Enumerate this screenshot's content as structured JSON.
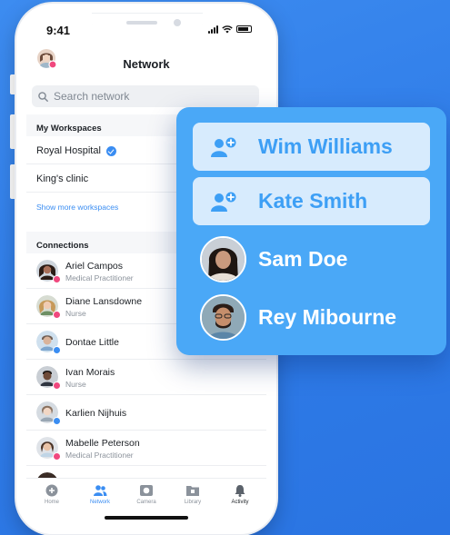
{
  "status": {
    "time": "9:41"
  },
  "header": {
    "title": "Network"
  },
  "search": {
    "placeholder": "Search network"
  },
  "workspaces": {
    "heading": "My Workspaces",
    "items": [
      {
        "name": "Royal Hospital",
        "verified": true
      },
      {
        "name": "King's clinic",
        "verified": false
      }
    ],
    "show_more": "Show more workspaces"
  },
  "connections": {
    "heading": "Connections",
    "items": [
      {
        "name": "Ariel Campos",
        "role": "Medical Practitioner",
        "badge": "pink"
      },
      {
        "name": "Diane Lansdowne",
        "role": "Nurse",
        "badge": "pink"
      },
      {
        "name": "Dontae Little",
        "role": "",
        "badge": "blue"
      },
      {
        "name": "Ivan Morais",
        "role": "Nurse",
        "badge": "pink"
      },
      {
        "name": "Karlien Nijhuis",
        "role": "",
        "badge": "blue"
      },
      {
        "name": "Mabelle Peterson",
        "role": "Medical Practitioner",
        "badge": "pink"
      }
    ]
  },
  "tabs": [
    {
      "label": "Home",
      "icon": "home-icon",
      "active": false
    },
    {
      "label": "Network",
      "icon": "people-icon",
      "active": true
    },
    {
      "label": "Camera",
      "icon": "camera-icon",
      "active": false
    },
    {
      "label": "Library",
      "icon": "library-icon",
      "active": false
    },
    {
      "label": "Activity",
      "icon": "bell-icon",
      "active": false
    }
  ],
  "card": {
    "invites": [
      {
        "name": "Wim Williams"
      },
      {
        "name": "Kate Smith"
      }
    ],
    "members": [
      {
        "name": "Sam Doe"
      },
      {
        "name": "Rey Mibourne"
      }
    ]
  },
  "colors": {
    "accent": "#3a8df2",
    "card": "#4aa8f7",
    "pill": "#d7ebfd",
    "badge_pink": "#f0487e",
    "background": "#2f7ce8"
  }
}
